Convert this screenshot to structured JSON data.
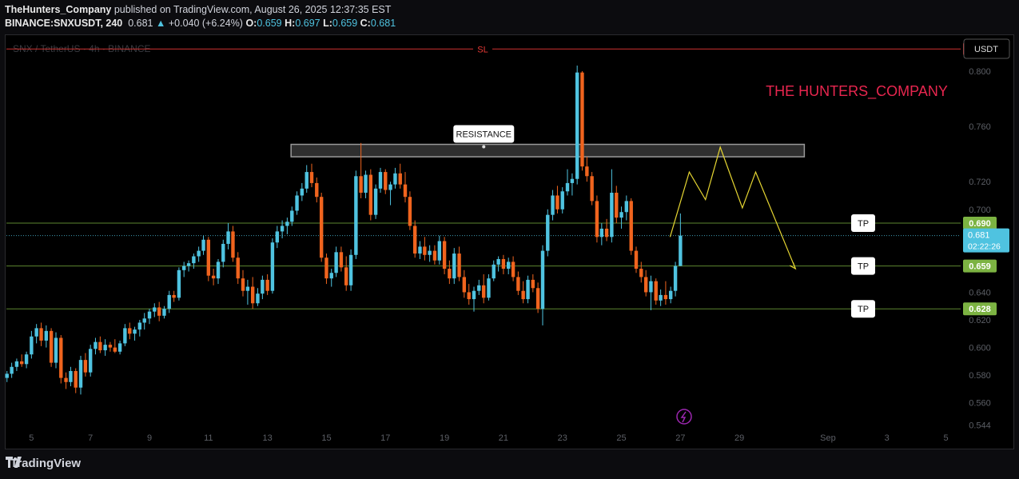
{
  "publisher": {
    "author": "TheHunters_Company",
    "text": "published on TradingView.com, August 26, 2025 12:37:35 EST"
  },
  "ticker": {
    "symbol": "BINANCE:SNXUSDT, 240",
    "last": "0.681",
    "change_arrow": "▲",
    "change": "+0.040 (+6.24%)",
    "o_label": "O:",
    "o": "0.659",
    "h_label": "H:",
    "h": "0.697",
    "l_label": "L:",
    "l": "0.659",
    "c_label": "C:",
    "c": "0.681"
  },
  "watermark": "SNX / TetherUS · 4h · BINANCE",
  "currency_button": "USDT",
  "brand_text": "THE HUNTERS_COMPANY",
  "footer_brand": "TradingView",
  "chart_data": {
    "type": "candlestick",
    "y_range": [
      0.539,
      0.826
    ],
    "y_ticks": [
      "0.800",
      "0.760",
      "0.720",
      "0.700",
      "0.640",
      "0.620",
      "0.600",
      "0.580",
      "0.560",
      "0.544"
    ],
    "y_tick_values": [
      0.8,
      0.76,
      0.72,
      0.7,
      0.64,
      0.62,
      0.6,
      0.58,
      0.56,
      0.544
    ],
    "x_ticks": [
      "5",
      "7",
      "9",
      "11",
      "13",
      "15",
      "17",
      "19",
      "21",
      "23",
      "25",
      "27",
      "29",
      "Sep",
      "3",
      "5"
    ],
    "x_tick_days": [
      5,
      7,
      9,
      11,
      13,
      15,
      17,
      19,
      21,
      23,
      25,
      27,
      29,
      32,
      34,
      36
    ],
    "x_day_range": [
      4.15,
      36.5
    ],
    "colors": {
      "up": "#4fc3e0",
      "down": "#f0641e",
      "sl": "#e53935",
      "tp": "#7cb342",
      "zigzag": "#e6d632",
      "brand": "#e8264f"
    },
    "levels": [
      {
        "label": "SL",
        "value": 0.816,
        "price_label": "0.816",
        "kind": "sl"
      },
      {
        "label": "TP",
        "value": 0.69,
        "price_label": "0.690",
        "kind": "tp"
      },
      {
        "label": "TP",
        "value": 0.659,
        "price_label": "0.659",
        "kind": "tp"
      },
      {
        "label": "TP",
        "value": 0.628,
        "price_label": "0.628",
        "kind": "tp"
      }
    ],
    "current_price": {
      "value": 0.681,
      "label": "0.681",
      "countdown": "02:22:26"
    },
    "resistance": {
      "label": "RESISTANCE",
      "low": 0.738,
      "high": 0.747,
      "start_day": 13.8,
      "end_day": 31.2
    },
    "projection": {
      "days": [
        26.65,
        27.3,
        27.85,
        28.35,
        29.1,
        29.55,
        30.9
      ],
      "values": [
        0.68,
        0.727,
        0.707,
        0.745,
        0.701,
        0.727,
        0.657
      ]
    },
    "candles": [
      {
        "d": 4.17,
        "o": 0.578,
        "h": 0.583,
        "l": 0.575,
        "c": 0.581
      },
      {
        "d": 4.33,
        "o": 0.581,
        "h": 0.589,
        "l": 0.578,
        "c": 0.586
      },
      {
        "d": 4.5,
        "o": 0.586,
        "h": 0.592,
        "l": 0.583,
        "c": 0.59
      },
      {
        "d": 4.67,
        "o": 0.59,
        "h": 0.595,
        "l": 0.586,
        "c": 0.588
      },
      {
        "d": 4.83,
        "o": 0.588,
        "h": 0.597,
        "l": 0.585,
        "c": 0.595
      },
      {
        "d": 5.0,
        "o": 0.595,
        "h": 0.612,
        "l": 0.592,
        "c": 0.608
      },
      {
        "d": 5.17,
        "o": 0.608,
        "h": 0.617,
        "l": 0.603,
        "c": 0.614
      },
      {
        "d": 5.33,
        "o": 0.614,
        "h": 0.618,
        "l": 0.601,
        "c": 0.605
      },
      {
        "d": 5.5,
        "o": 0.605,
        "h": 0.616,
        "l": 0.6,
        "c": 0.612
      },
      {
        "d": 5.67,
        "o": 0.612,
        "h": 0.614,
        "l": 0.586,
        "c": 0.589
      },
      {
        "d": 5.83,
        "o": 0.589,
        "h": 0.611,
        "l": 0.585,
        "c": 0.607
      },
      {
        "d": 6.0,
        "o": 0.607,
        "h": 0.609,
        "l": 0.574,
        "c": 0.578
      },
      {
        "d": 6.17,
        "o": 0.578,
        "h": 0.582,
        "l": 0.57,
        "c": 0.575
      },
      {
        "d": 6.33,
        "o": 0.575,
        "h": 0.586,
        "l": 0.572,
        "c": 0.583
      },
      {
        "d": 6.5,
        "o": 0.583,
        "h": 0.585,
        "l": 0.567,
        "c": 0.571
      },
      {
        "d": 6.67,
        "o": 0.571,
        "h": 0.594,
        "l": 0.566,
        "c": 0.591
      },
      {
        "d": 6.83,
        "o": 0.591,
        "h": 0.596,
        "l": 0.579,
        "c": 0.582
      },
      {
        "d": 7.0,
        "o": 0.582,
        "h": 0.602,
        "l": 0.579,
        "c": 0.599
      },
      {
        "d": 7.17,
        "o": 0.599,
        "h": 0.607,
        "l": 0.595,
        "c": 0.604
      },
      {
        "d": 7.33,
        "o": 0.604,
        "h": 0.608,
        "l": 0.596,
        "c": 0.598
      },
      {
        "d": 7.5,
        "o": 0.598,
        "h": 0.606,
        "l": 0.594,
        "c": 0.602
      },
      {
        "d": 7.67,
        "o": 0.602,
        "h": 0.604,
        "l": 0.597,
        "c": 0.6
      },
      {
        "d": 7.83,
        "o": 0.6,
        "h": 0.606,
        "l": 0.596,
        "c": 0.597
      },
      {
        "d": 8.0,
        "o": 0.597,
        "h": 0.605,
        "l": 0.595,
        "c": 0.603
      },
      {
        "d": 8.17,
        "o": 0.603,
        "h": 0.617,
        "l": 0.601,
        "c": 0.614
      },
      {
        "d": 8.33,
        "o": 0.614,
        "h": 0.618,
        "l": 0.606,
        "c": 0.61
      },
      {
        "d": 8.5,
        "o": 0.61,
        "h": 0.615,
        "l": 0.605,
        "c": 0.613
      },
      {
        "d": 8.67,
        "o": 0.613,
        "h": 0.62,
        "l": 0.608,
        "c": 0.618
      },
      {
        "d": 8.83,
        "o": 0.618,
        "h": 0.625,
        "l": 0.613,
        "c": 0.621
      },
      {
        "d": 9.0,
        "o": 0.621,
        "h": 0.628,
        "l": 0.617,
        "c": 0.626
      },
      {
        "d": 9.17,
        "o": 0.626,
        "h": 0.632,
        "l": 0.622,
        "c": 0.629
      },
      {
        "d": 9.33,
        "o": 0.629,
        "h": 0.633,
        "l": 0.619,
        "c": 0.623
      },
      {
        "d": 9.5,
        "o": 0.623,
        "h": 0.63,
        "l": 0.621,
        "c": 0.628
      },
      {
        "d": 9.67,
        "o": 0.628,
        "h": 0.641,
        "l": 0.625,
        "c": 0.638
      },
      {
        "d": 9.83,
        "o": 0.638,
        "h": 0.641,
        "l": 0.633,
        "c": 0.636
      },
      {
        "d": 10.0,
        "o": 0.636,
        "h": 0.658,
        "l": 0.634,
        "c": 0.656
      },
      {
        "d": 10.17,
        "o": 0.656,
        "h": 0.662,
        "l": 0.651,
        "c": 0.659
      },
      {
        "d": 10.33,
        "o": 0.659,
        "h": 0.663,
        "l": 0.655,
        "c": 0.661
      },
      {
        "d": 10.5,
        "o": 0.661,
        "h": 0.668,
        "l": 0.657,
        "c": 0.666
      },
      {
        "d": 10.67,
        "o": 0.666,
        "h": 0.673,
        "l": 0.662,
        "c": 0.67
      },
      {
        "d": 10.83,
        "o": 0.67,
        "h": 0.681,
        "l": 0.667,
        "c": 0.678
      },
      {
        "d": 11.0,
        "o": 0.678,
        "h": 0.68,
        "l": 0.648,
        "c": 0.652
      },
      {
        "d": 11.17,
        "o": 0.652,
        "h": 0.657,
        "l": 0.645,
        "c": 0.65
      },
      {
        "d": 11.33,
        "o": 0.65,
        "h": 0.664,
        "l": 0.646,
        "c": 0.662
      },
      {
        "d": 11.5,
        "o": 0.662,
        "h": 0.678,
        "l": 0.658,
        "c": 0.675
      },
      {
        "d": 11.67,
        "o": 0.675,
        "h": 0.69,
        "l": 0.671,
        "c": 0.684
      },
      {
        "d": 11.83,
        "o": 0.684,
        "h": 0.688,
        "l": 0.662,
        "c": 0.665
      },
      {
        "d": 12.0,
        "o": 0.665,
        "h": 0.669,
        "l": 0.646,
        "c": 0.65
      },
      {
        "d": 12.17,
        "o": 0.65,
        "h": 0.656,
        "l": 0.637,
        "c": 0.641
      },
      {
        "d": 12.33,
        "o": 0.641,
        "h": 0.649,
        "l": 0.631,
        "c": 0.644
      },
      {
        "d": 12.5,
        "o": 0.644,
        "h": 0.651,
        "l": 0.628,
        "c": 0.632
      },
      {
        "d": 12.67,
        "o": 0.632,
        "h": 0.643,
        "l": 0.63,
        "c": 0.639
      },
      {
        "d": 12.83,
        "o": 0.639,
        "h": 0.652,
        "l": 0.635,
        "c": 0.649
      },
      {
        "d": 13.0,
        "o": 0.649,
        "h": 0.653,
        "l": 0.638,
        "c": 0.641
      },
      {
        "d": 13.17,
        "o": 0.641,
        "h": 0.679,
        "l": 0.639,
        "c": 0.676
      },
      {
        "d": 13.33,
        "o": 0.676,
        "h": 0.688,
        "l": 0.672,
        "c": 0.684
      },
      {
        "d": 13.5,
        "o": 0.684,
        "h": 0.692,
        "l": 0.679,
        "c": 0.688
      },
      {
        "d": 13.67,
        "o": 0.688,
        "h": 0.694,
        "l": 0.682,
        "c": 0.691
      },
      {
        "d": 13.83,
        "o": 0.691,
        "h": 0.702,
        "l": 0.688,
        "c": 0.699
      },
      {
        "d": 14.0,
        "o": 0.699,
        "h": 0.713,
        "l": 0.696,
        "c": 0.71
      },
      {
        "d": 14.17,
        "o": 0.71,
        "h": 0.719,
        "l": 0.706,
        "c": 0.715
      },
      {
        "d": 14.33,
        "o": 0.715,
        "h": 0.732,
        "l": 0.712,
        "c": 0.727
      },
      {
        "d": 14.5,
        "o": 0.727,
        "h": 0.733,
        "l": 0.716,
        "c": 0.719
      },
      {
        "d": 14.67,
        "o": 0.719,
        "h": 0.723,
        "l": 0.705,
        "c": 0.709
      },
      {
        "d": 14.83,
        "o": 0.709,
        "h": 0.712,
        "l": 0.662,
        "c": 0.665
      },
      {
        "d": 15.0,
        "o": 0.665,
        "h": 0.668,
        "l": 0.646,
        "c": 0.65
      },
      {
        "d": 15.17,
        "o": 0.65,
        "h": 0.657,
        "l": 0.644,
        "c": 0.654
      },
      {
        "d": 15.33,
        "o": 0.654,
        "h": 0.673,
        "l": 0.651,
        "c": 0.669
      },
      {
        "d": 15.5,
        "o": 0.669,
        "h": 0.673,
        "l": 0.655,
        "c": 0.658
      },
      {
        "d": 15.67,
        "o": 0.658,
        "h": 0.666,
        "l": 0.641,
        "c": 0.645
      },
      {
        "d": 15.83,
        "o": 0.645,
        "h": 0.671,
        "l": 0.641,
        "c": 0.667
      },
      {
        "d": 16.0,
        "o": 0.667,
        "h": 0.728,
        "l": 0.664,
        "c": 0.724
      },
      {
        "d": 16.17,
        "o": 0.724,
        "h": 0.748,
        "l": 0.708,
        "c": 0.712
      },
      {
        "d": 16.33,
        "o": 0.712,
        "h": 0.728,
        "l": 0.708,
        "c": 0.725
      },
      {
        "d": 16.5,
        "o": 0.725,
        "h": 0.729,
        "l": 0.692,
        "c": 0.696
      },
      {
        "d": 16.67,
        "o": 0.696,
        "h": 0.718,
        "l": 0.693,
        "c": 0.715
      },
      {
        "d": 16.83,
        "o": 0.715,
        "h": 0.73,
        "l": 0.712,
        "c": 0.727
      },
      {
        "d": 17.0,
        "o": 0.727,
        "h": 0.729,
        "l": 0.711,
        "c": 0.714
      },
      {
        "d": 17.17,
        "o": 0.714,
        "h": 0.72,
        "l": 0.703,
        "c": 0.718
      },
      {
        "d": 17.33,
        "o": 0.718,
        "h": 0.73,
        "l": 0.715,
        "c": 0.726
      },
      {
        "d": 17.5,
        "o": 0.726,
        "h": 0.733,
        "l": 0.715,
        "c": 0.718
      },
      {
        "d": 17.67,
        "o": 0.718,
        "h": 0.727,
        "l": 0.705,
        "c": 0.709
      },
      {
        "d": 17.83,
        "o": 0.709,
        "h": 0.713,
        "l": 0.685,
        "c": 0.688
      },
      {
        "d": 18.0,
        "o": 0.688,
        "h": 0.692,
        "l": 0.665,
        "c": 0.668
      },
      {
        "d": 18.17,
        "o": 0.668,
        "h": 0.677,
        "l": 0.664,
        "c": 0.673
      },
      {
        "d": 18.33,
        "o": 0.673,
        "h": 0.68,
        "l": 0.663,
        "c": 0.667
      },
      {
        "d": 18.5,
        "o": 0.667,
        "h": 0.674,
        "l": 0.662,
        "c": 0.67
      },
      {
        "d": 18.67,
        "o": 0.67,
        "h": 0.674,
        "l": 0.66,
        "c": 0.663
      },
      {
        "d": 18.83,
        "o": 0.663,
        "h": 0.681,
        "l": 0.66,
        "c": 0.677
      },
      {
        "d": 19.0,
        "o": 0.677,
        "h": 0.68,
        "l": 0.653,
        "c": 0.657
      },
      {
        "d": 19.17,
        "o": 0.657,
        "h": 0.663,
        "l": 0.646,
        "c": 0.65
      },
      {
        "d": 19.33,
        "o": 0.65,
        "h": 0.672,
        "l": 0.646,
        "c": 0.668
      },
      {
        "d": 19.5,
        "o": 0.668,
        "h": 0.673,
        "l": 0.648,
        "c": 0.651
      },
      {
        "d": 19.67,
        "o": 0.651,
        "h": 0.656,
        "l": 0.636,
        "c": 0.64
      },
      {
        "d": 19.83,
        "o": 0.64,
        "h": 0.646,
        "l": 0.631,
        "c": 0.635
      },
      {
        "d": 20.0,
        "o": 0.635,
        "h": 0.644,
        "l": 0.626,
        "c": 0.641
      },
      {
        "d": 20.17,
        "o": 0.641,
        "h": 0.649,
        "l": 0.638,
        "c": 0.645
      },
      {
        "d": 20.33,
        "o": 0.645,
        "h": 0.653,
        "l": 0.632,
        "c": 0.636
      },
      {
        "d": 20.5,
        "o": 0.636,
        "h": 0.653,
        "l": 0.634,
        "c": 0.65
      },
      {
        "d": 20.67,
        "o": 0.65,
        "h": 0.663,
        "l": 0.648,
        "c": 0.66
      },
      {
        "d": 20.83,
        "o": 0.66,
        "h": 0.666,
        "l": 0.655,
        "c": 0.664
      },
      {
        "d": 21.0,
        "o": 0.664,
        "h": 0.667,
        "l": 0.653,
        "c": 0.657
      },
      {
        "d": 21.17,
        "o": 0.657,
        "h": 0.665,
        "l": 0.653,
        "c": 0.662
      },
      {
        "d": 21.33,
        "o": 0.662,
        "h": 0.666,
        "l": 0.648,
        "c": 0.651
      },
      {
        "d": 21.5,
        "o": 0.651,
        "h": 0.655,
        "l": 0.638,
        "c": 0.641
      },
      {
        "d": 21.67,
        "o": 0.641,
        "h": 0.648,
        "l": 0.632,
        "c": 0.635
      },
      {
        "d": 21.83,
        "o": 0.635,
        "h": 0.652,
        "l": 0.632,
        "c": 0.649
      },
      {
        "d": 22.0,
        "o": 0.649,
        "h": 0.653,
        "l": 0.64,
        "c": 0.643
      },
      {
        "d": 22.17,
        "o": 0.643,
        "h": 0.647,
        "l": 0.625,
        "c": 0.628
      },
      {
        "d": 22.33,
        "o": 0.628,
        "h": 0.674,
        "l": 0.616,
        "c": 0.67
      },
      {
        "d": 22.5,
        "o": 0.67,
        "h": 0.7,
        "l": 0.666,
        "c": 0.696
      },
      {
        "d": 22.67,
        "o": 0.696,
        "h": 0.714,
        "l": 0.692,
        "c": 0.71
      },
      {
        "d": 22.83,
        "o": 0.71,
        "h": 0.717,
        "l": 0.697,
        "c": 0.7
      },
      {
        "d": 23.0,
        "o": 0.7,
        "h": 0.716,
        "l": 0.697,
        "c": 0.713
      },
      {
        "d": 23.17,
        "o": 0.713,
        "h": 0.729,
        "l": 0.71,
        "c": 0.719
      },
      {
        "d": 23.33,
        "o": 0.719,
        "h": 0.726,
        "l": 0.71,
        "c": 0.722
      },
      {
        "d": 23.5,
        "o": 0.722,
        "h": 0.804,
        "l": 0.718,
        "c": 0.799
      },
      {
        "d": 23.67,
        "o": 0.799,
        "h": 0.8,
        "l": 0.728,
        "c": 0.731
      },
      {
        "d": 23.83,
        "o": 0.731,
        "h": 0.738,
        "l": 0.72,
        "c": 0.724
      },
      {
        "d": 24.0,
        "o": 0.724,
        "h": 0.727,
        "l": 0.703,
        "c": 0.706
      },
      {
        "d": 24.17,
        "o": 0.706,
        "h": 0.71,
        "l": 0.676,
        "c": 0.68
      },
      {
        "d": 24.33,
        "o": 0.68,
        "h": 0.69,
        "l": 0.674,
        "c": 0.686
      },
      {
        "d": 24.5,
        "o": 0.686,
        "h": 0.693,
        "l": 0.677,
        "c": 0.68
      },
      {
        "d": 24.67,
        "o": 0.68,
        "h": 0.729,
        "l": 0.676,
        "c": 0.712
      },
      {
        "d": 24.83,
        "o": 0.712,
        "h": 0.717,
        "l": 0.69,
        "c": 0.694
      },
      {
        "d": 25.0,
        "o": 0.694,
        "h": 0.702,
        "l": 0.686,
        "c": 0.698
      },
      {
        "d": 25.17,
        "o": 0.698,
        "h": 0.71,
        "l": 0.692,
        "c": 0.706
      },
      {
        "d": 25.33,
        "o": 0.706,
        "h": 0.708,
        "l": 0.667,
        "c": 0.67
      },
      {
        "d": 25.5,
        "o": 0.67,
        "h": 0.673,
        "l": 0.654,
        "c": 0.657
      },
      {
        "d": 25.67,
        "o": 0.657,
        "h": 0.662,
        "l": 0.647,
        "c": 0.651
      },
      {
        "d": 25.83,
        "o": 0.651,
        "h": 0.656,
        "l": 0.637,
        "c": 0.64
      },
      {
        "d": 26.0,
        "o": 0.64,
        "h": 0.652,
        "l": 0.627,
        "c": 0.648
      },
      {
        "d": 26.17,
        "o": 0.648,
        "h": 0.65,
        "l": 0.631,
        "c": 0.634
      },
      {
        "d": 26.33,
        "o": 0.634,
        "h": 0.642,
        "l": 0.63,
        "c": 0.638
      },
      {
        "d": 26.5,
        "o": 0.638,
        "h": 0.648,
        "l": 0.631,
        "c": 0.635
      },
      {
        "d": 26.67,
        "o": 0.635,
        "h": 0.644,
        "l": 0.632,
        "c": 0.641
      },
      {
        "d": 26.83,
        "o": 0.641,
        "h": 0.662,
        "l": 0.637,
        "c": 0.659
      },
      {
        "d": 27.0,
        "o": 0.659,
        "h": 0.697,
        "l": 0.659,
        "c": 0.681
      }
    ]
  }
}
